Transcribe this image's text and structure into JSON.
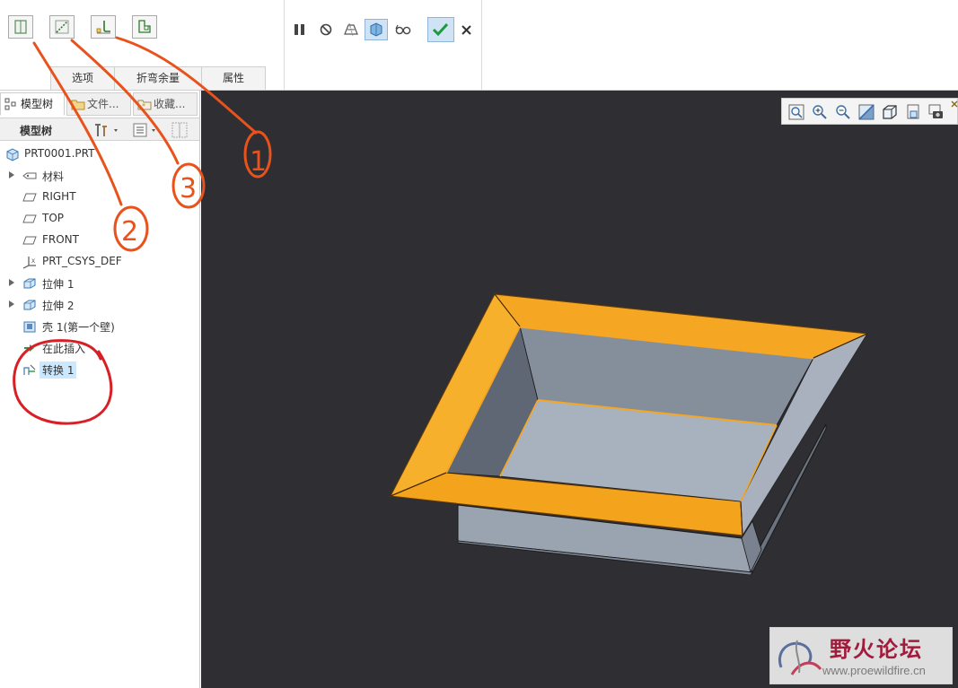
{
  "ribbon": {
    "tool_buttons": [
      {
        "name": "flat-wall-icon"
      },
      {
        "name": "edge-rip-icon"
      },
      {
        "name": "bend-corner-icon"
      },
      {
        "name": "corner-relief-icon"
      }
    ],
    "sub_tabs": [
      "选项",
      "折弯余量",
      "属性"
    ],
    "controls": [
      "pause-icon",
      "stop-icon",
      "preview-icon",
      "verify-icon",
      "glasses-icon",
      "ok-check-icon",
      "cancel-x-icon"
    ]
  },
  "left_panel": {
    "tabs": [
      {
        "label": "模型树",
        "icon": "model-tree-icon"
      },
      {
        "label": "文件...",
        "icon": "folder-icon"
      },
      {
        "label": "收藏...",
        "icon": "favorites-icon"
      }
    ],
    "tree_header": {
      "label": "模型树"
    },
    "tree": [
      {
        "label": "PRT0001.PRT",
        "icon": "part-icon",
        "expandable": false
      },
      {
        "label": "材料",
        "icon": "material-icon",
        "expandable": true
      },
      {
        "label": "RIGHT",
        "icon": "datum-plane-icon",
        "expandable": false
      },
      {
        "label": "TOP",
        "icon": "datum-plane-icon",
        "expandable": false
      },
      {
        "label": "FRONT",
        "icon": "datum-plane-icon",
        "expandable": false
      },
      {
        "label": "PRT_CSYS_DEF",
        "icon": "csys-icon",
        "expandable": false
      },
      {
        "label": "拉伸 1",
        "icon": "extrude-icon",
        "expandable": true
      },
      {
        "label": "拉伸 2",
        "icon": "extrude-icon",
        "expandable": true
      },
      {
        "label": "壳 1(第一个壁)",
        "icon": "shell-icon",
        "expandable": false
      },
      {
        "label": "在此插入",
        "icon": "insert-here-icon",
        "expandable": false
      },
      {
        "label": "转换 1",
        "icon": "convert-icon",
        "expandable": false,
        "selected": true
      }
    ]
  },
  "viewport": {
    "background": "#2e2e33",
    "model_colors": {
      "flange": "#f5a623",
      "wall": "#9ea7b3",
      "inner": "#a8b2be",
      "shadow": "#6b7380"
    },
    "view_toolbar": [
      "refit-icon",
      "zoom-in-icon",
      "zoom-out-icon",
      "repaint-icon",
      "display-style-icon",
      "saved-views-icon",
      "screenshot-icon"
    ]
  },
  "annotations": {
    "color": "#e8521c",
    "circle_color": "#d81f26",
    "labels": [
      "1",
      "2",
      "3"
    ]
  },
  "watermark": {
    "title": "野火论坛",
    "url": "www.proewildfire.cn"
  }
}
